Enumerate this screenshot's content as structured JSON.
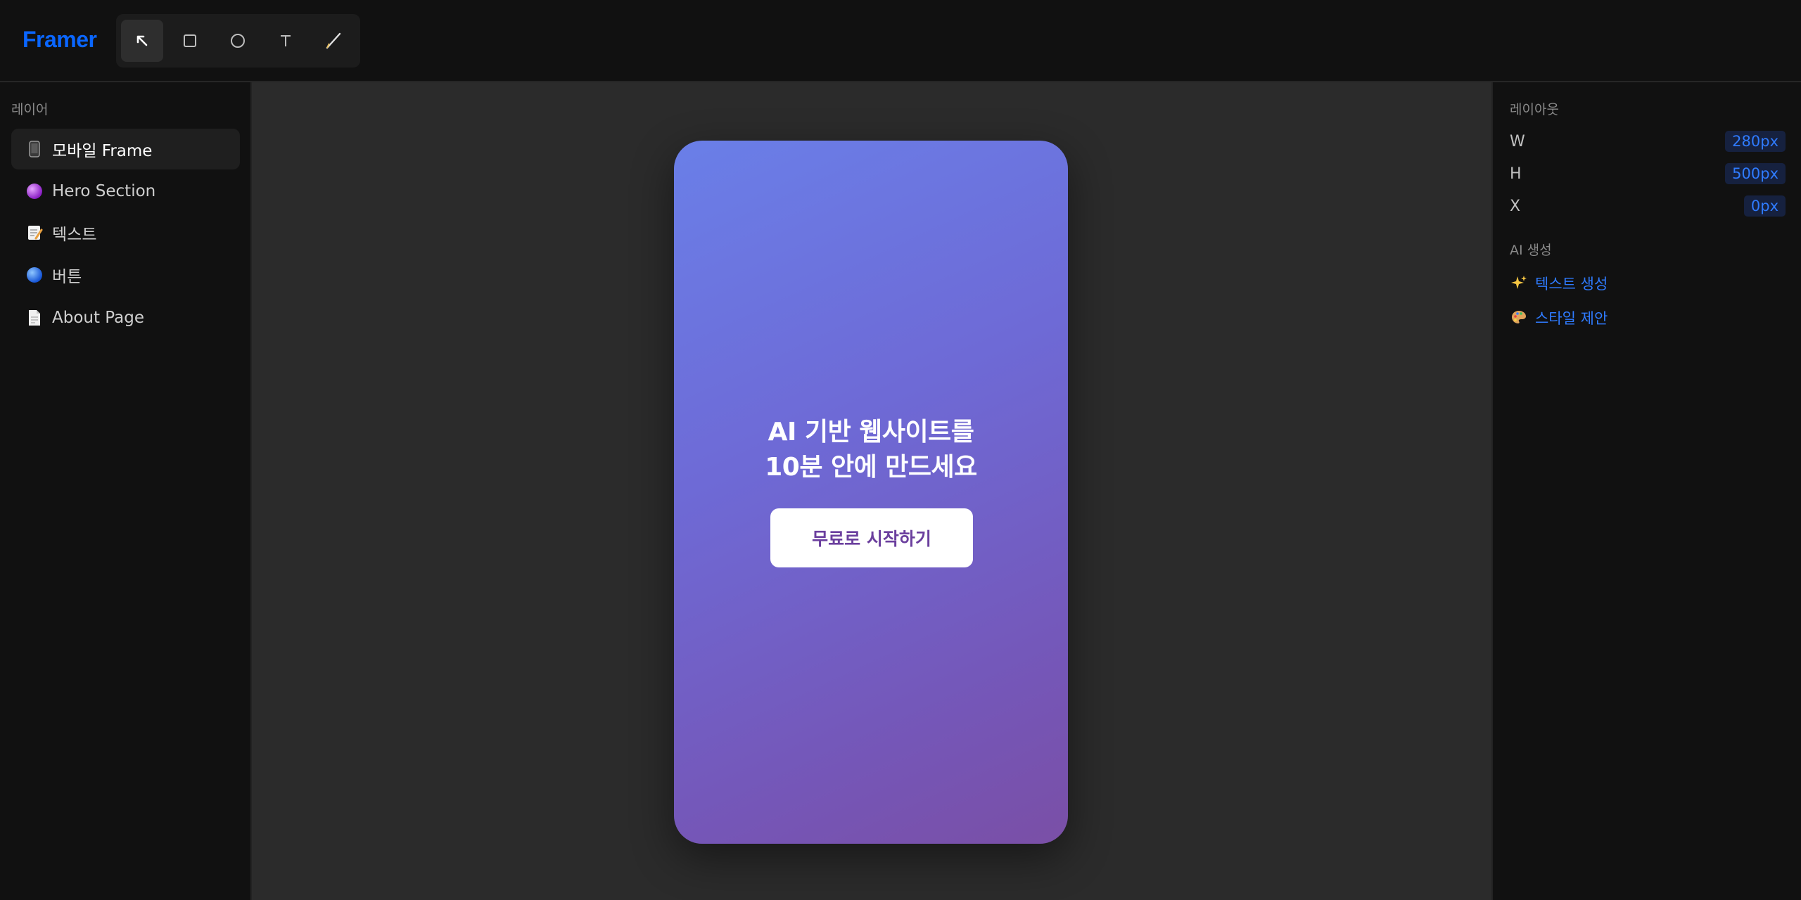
{
  "app": {
    "name": "Framer"
  },
  "toolbar": {
    "tools": [
      {
        "name": "select",
        "icon": "arrow-cursor-icon",
        "active": true
      },
      {
        "name": "frame",
        "icon": "square-icon",
        "active": false
      },
      {
        "name": "ellipse",
        "icon": "circle-icon",
        "active": false
      },
      {
        "name": "text",
        "icon": "text-icon",
        "active": false
      },
      {
        "name": "pen",
        "icon": "pen-icon",
        "active": false
      }
    ]
  },
  "layers": {
    "title": "레이어",
    "items": [
      {
        "label": "모바일 Frame",
        "icon": "mobile-phone-icon",
        "selected": true
      },
      {
        "label": "Hero Section",
        "icon": "purple-circle-icon",
        "selected": false
      },
      {
        "label": "텍스트",
        "icon": "memo-icon",
        "selected": false
      },
      {
        "label": "버튼",
        "icon": "blue-circle-icon",
        "selected": false
      },
      {
        "label": "About Page",
        "icon": "page-icon",
        "selected": false
      }
    ]
  },
  "canvas": {
    "hero_title": "AI 기반 웹사이트를\n10분 안에 만드세요",
    "cta_label": "무료로 시작하기",
    "gradient_start": "#6a7fe8",
    "gradient_end": "#7a4fa6"
  },
  "properties": {
    "layout_title": "레이아웃",
    "rows": [
      {
        "label": "W",
        "value": "280px"
      },
      {
        "label": "H",
        "value": "500px"
      },
      {
        "label": "X",
        "value": "0px"
      }
    ],
    "ai_title": "AI 생성",
    "ai_actions": [
      {
        "label": "텍스트 생성",
        "icon": "sparkles-icon"
      },
      {
        "label": "스타일 제안",
        "icon": "palette-icon"
      }
    ]
  },
  "colors": {
    "accent": "#0a66ff",
    "link": "#2f7bff",
    "canvas_bg": "#2b2b2b",
    "panel_bg": "#111111"
  }
}
